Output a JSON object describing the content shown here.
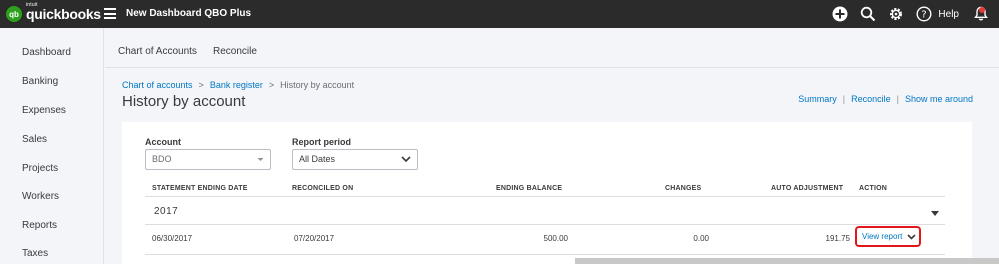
{
  "topbar": {
    "logo_badge": "qb",
    "logo_small": "intuit",
    "logo_main": "quickbooks",
    "company_name": "New Dashboard QBO Plus",
    "help_label": "Help",
    "icons": [
      "plus-circle-icon",
      "search-icon",
      "gear-icon",
      "help-icon",
      "bell-icon"
    ]
  },
  "sidebar": {
    "items": [
      {
        "label": "Dashboard"
      },
      {
        "label": "Banking"
      },
      {
        "label": "Expenses"
      },
      {
        "label": "Sales"
      },
      {
        "label": "Projects"
      },
      {
        "label": "Workers"
      },
      {
        "label": "Reports"
      },
      {
        "label": "Taxes"
      }
    ]
  },
  "tabs": [
    {
      "label": "Chart of Accounts"
    },
    {
      "label": "Reconcile"
    }
  ],
  "breadcrumb": {
    "items": [
      {
        "label": "Chart of accounts"
      },
      {
        "label": "Bank register"
      }
    ],
    "separator": ">",
    "current": "History by account"
  },
  "page_title": "History by account",
  "right_links": {
    "summary": "Summary",
    "reconcile": "Reconcile",
    "show_me_around": "Show me around",
    "separator": "|"
  },
  "filters": {
    "account": {
      "label": "Account",
      "value": "BDO"
    },
    "report_period": {
      "label": "Report period",
      "value": "All Dates"
    }
  },
  "table": {
    "columns": [
      "STATEMENT ENDING DATE",
      "RECONCILED ON",
      "ENDING BALANCE",
      "CHANGES",
      "AUTO ADJUSTMENT",
      "ACTION"
    ],
    "group": "2017",
    "rows": [
      {
        "statement_ending_date": "06/30/2017",
        "reconciled_on": "07/20/2017",
        "ending_balance": "500.00",
        "changes": "0.00",
        "auto_adjustment": "191.75",
        "action": "View report"
      }
    ]
  },
  "colors": {
    "topbar_bg": "#2b2b2b",
    "link": "#0077c5",
    "brand_green": "#2ca01c",
    "highlight_red": "#e3161b"
  }
}
